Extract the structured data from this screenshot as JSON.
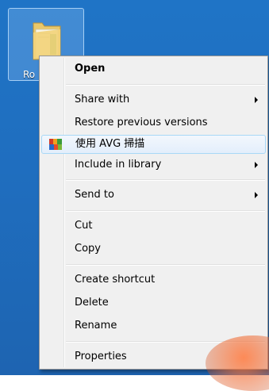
{
  "desktop": {
    "folder_label": "Ro"
  },
  "context_menu": {
    "open": "Open",
    "share_with": "Share with",
    "restore_previous_versions": "Restore previous versions",
    "scan_with_avg": "使用 AVG 掃描",
    "include_in_library": "Include in library",
    "send_to": "Send to",
    "cut": "Cut",
    "copy": "Copy",
    "create_shortcut": "Create shortcut",
    "delete": "Delete",
    "rename": "Rename",
    "properties": "Properties"
  },
  "icons": {
    "folder": "folder-icon",
    "avg": "avg-icon",
    "submenu_arrow": "submenu-arrow-icon"
  },
  "colors": {
    "desktop_background": "#1f6ebf",
    "menu_background": "#f0f0f0",
    "highlight_border": "#a8d8f7"
  }
}
